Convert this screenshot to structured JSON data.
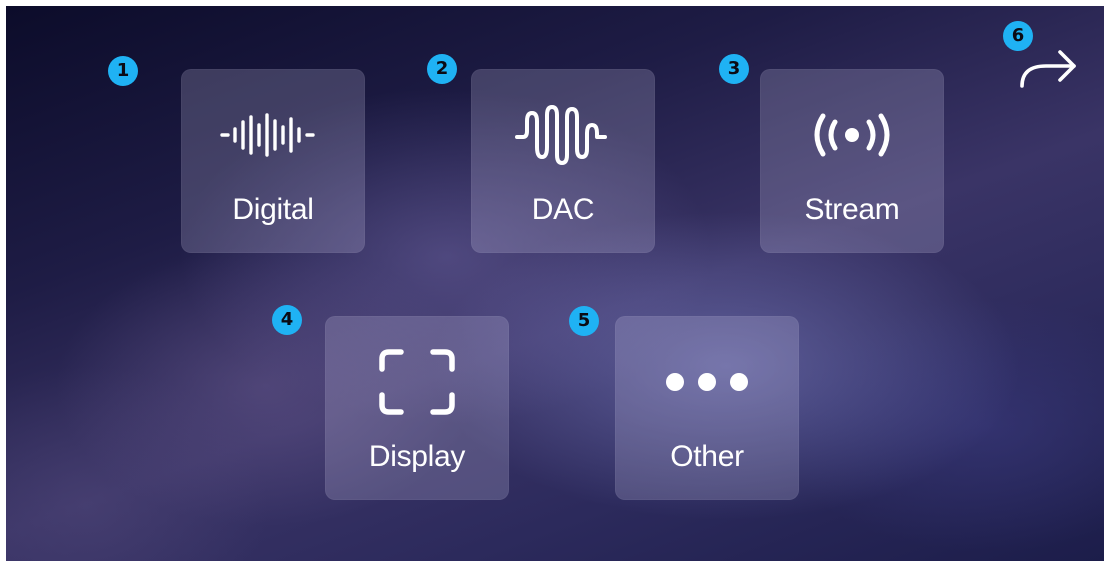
{
  "tiles": [
    {
      "label": "Digital",
      "badge": "1",
      "icon": "waveform-digital-icon"
    },
    {
      "label": "DAC",
      "badge": "2",
      "icon": "analog-wave-icon"
    },
    {
      "label": "Stream",
      "badge": "3",
      "icon": "broadcast-icon"
    },
    {
      "label": "Display",
      "badge": "4",
      "icon": "display-frame-icon"
    },
    {
      "label": "Other",
      "badge": "5",
      "icon": "more-dots-icon"
    }
  ],
  "next": {
    "badge": "6",
    "icon": "forward-arrow-icon"
  },
  "colors": {
    "badge": "#1fb2f4",
    "tile": "rgba(210,205,235,0.22)",
    "text": "#ffffff"
  }
}
